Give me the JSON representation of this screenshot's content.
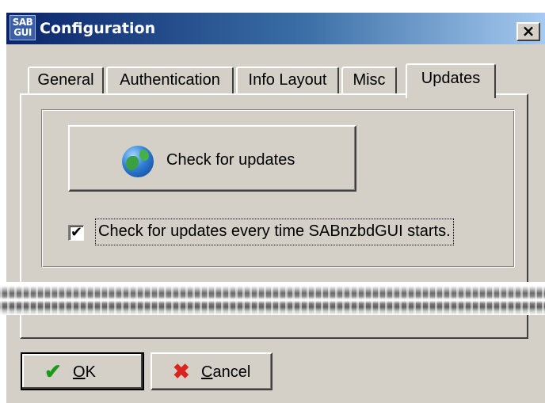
{
  "window": {
    "title": "Configuration",
    "app_icon_top": "SAB",
    "app_icon_bottom": "GUI",
    "close_glyph": "×"
  },
  "tabs": [
    {
      "label": "General",
      "active": false
    },
    {
      "label": "Authentication",
      "active": false
    },
    {
      "label": "Info Layout",
      "active": false
    },
    {
      "label": "Misc",
      "active": false
    },
    {
      "label": "Updates",
      "active": true
    }
  ],
  "updates": {
    "check_button_label": "Check for updates",
    "check_button_icon": "globe-icon",
    "auto_check_label": "Check for updates every time SABnzbdGUI starts.",
    "auto_check_checked": true,
    "check_glyph": "✔"
  },
  "footer": {
    "ok": {
      "mnemonic": "O",
      "rest": "K",
      "icon": "checkmark-icon",
      "glyph": "✔"
    },
    "cancel": {
      "mnemonic": "C",
      "rest": "ancel",
      "icon": "x-icon",
      "glyph": "✖"
    }
  },
  "colors": {
    "dialog_face": "#d4d0c8",
    "title_start": "#0a246a",
    "title_end": "#a6caf0",
    "ok_icon": "#1a9a1a",
    "cancel_icon": "#d8241c"
  }
}
